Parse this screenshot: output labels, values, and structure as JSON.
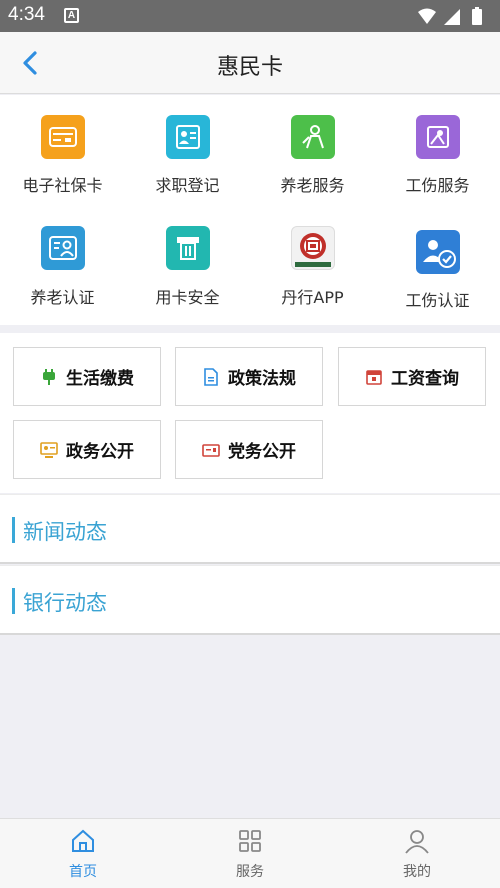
{
  "status": {
    "time": "4:34",
    "notif_icon": "A"
  },
  "header": {
    "title": "惠民卡"
  },
  "services": [
    {
      "label": "电子社保卡",
      "icon": "card-icon",
      "color": "#f5a11c"
    },
    {
      "label": "求职登记",
      "icon": "resume-icon",
      "color": "#28b6d8"
    },
    {
      "label": "养老服务",
      "icon": "elder-icon",
      "color": "#4dbf4a"
    },
    {
      "label": "工伤服务",
      "icon": "injury-icon",
      "color": "#9a67d8"
    },
    {
      "label": "养老认证",
      "icon": "id-icon",
      "color": "#2f9ad6"
    },
    {
      "label": "用卡安全",
      "icon": "atm-icon",
      "color": "#22b7b0"
    },
    {
      "label": "丹行APP",
      "icon": "bank-logo-icon",
      "color": "#c0302a"
    },
    {
      "label": "工伤认证",
      "icon": "verify-icon",
      "color": "#2f7fd6"
    }
  ],
  "cards": [
    {
      "label": "生活缴费",
      "icon": "plug-icon",
      "color": "#3aa63a"
    },
    {
      "label": "政策法规",
      "icon": "document-icon",
      "color": "#2f8ee0"
    },
    {
      "label": "工资查询",
      "icon": "calendar-icon",
      "color": "#d0443a"
    },
    {
      "label": "政务公开",
      "icon": "monitor-icon",
      "color": "#e0a020"
    },
    {
      "label": "党务公开",
      "icon": "ticket-icon",
      "color": "#d0443a"
    }
  ],
  "sections": [
    {
      "title": "新闻动态"
    },
    {
      "title": "银行动态"
    }
  ],
  "tabs": [
    {
      "label": "首页",
      "icon": "home-icon",
      "active": true
    },
    {
      "label": "服务",
      "icon": "grid-icon",
      "active": false
    },
    {
      "label": "我的",
      "icon": "user-icon",
      "active": false
    }
  ],
  "colors": {
    "accent": "#2f8ee0",
    "section_title": "#3aa3d3"
  }
}
